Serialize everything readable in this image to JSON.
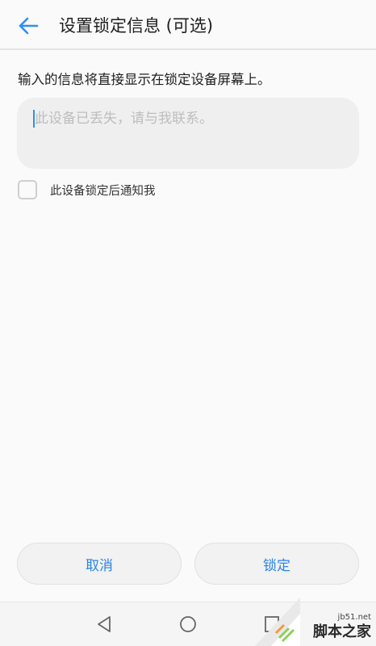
{
  "header": {
    "title": "设置锁定信息 (可选)",
    "back_icon": "arrow-left-icon",
    "accent": "#2f8ef6"
  },
  "description": "输入的信息将直接显示在锁定设备屏幕上。",
  "message_input": {
    "value": "",
    "placeholder": "此设备已丢失，请与我联系。"
  },
  "notify_option": {
    "label": "此设备锁定后通知我",
    "checked": false
  },
  "actions": {
    "cancel_label": "取消",
    "lock_label": "锁定",
    "button_text_color": "#2a84e6"
  },
  "navbar": {
    "icons": [
      "nav-back-icon",
      "nav-home-icon",
      "nav-recent-icon"
    ]
  },
  "watermark": {
    "site": "jb51.net",
    "name": "脚本之家"
  }
}
